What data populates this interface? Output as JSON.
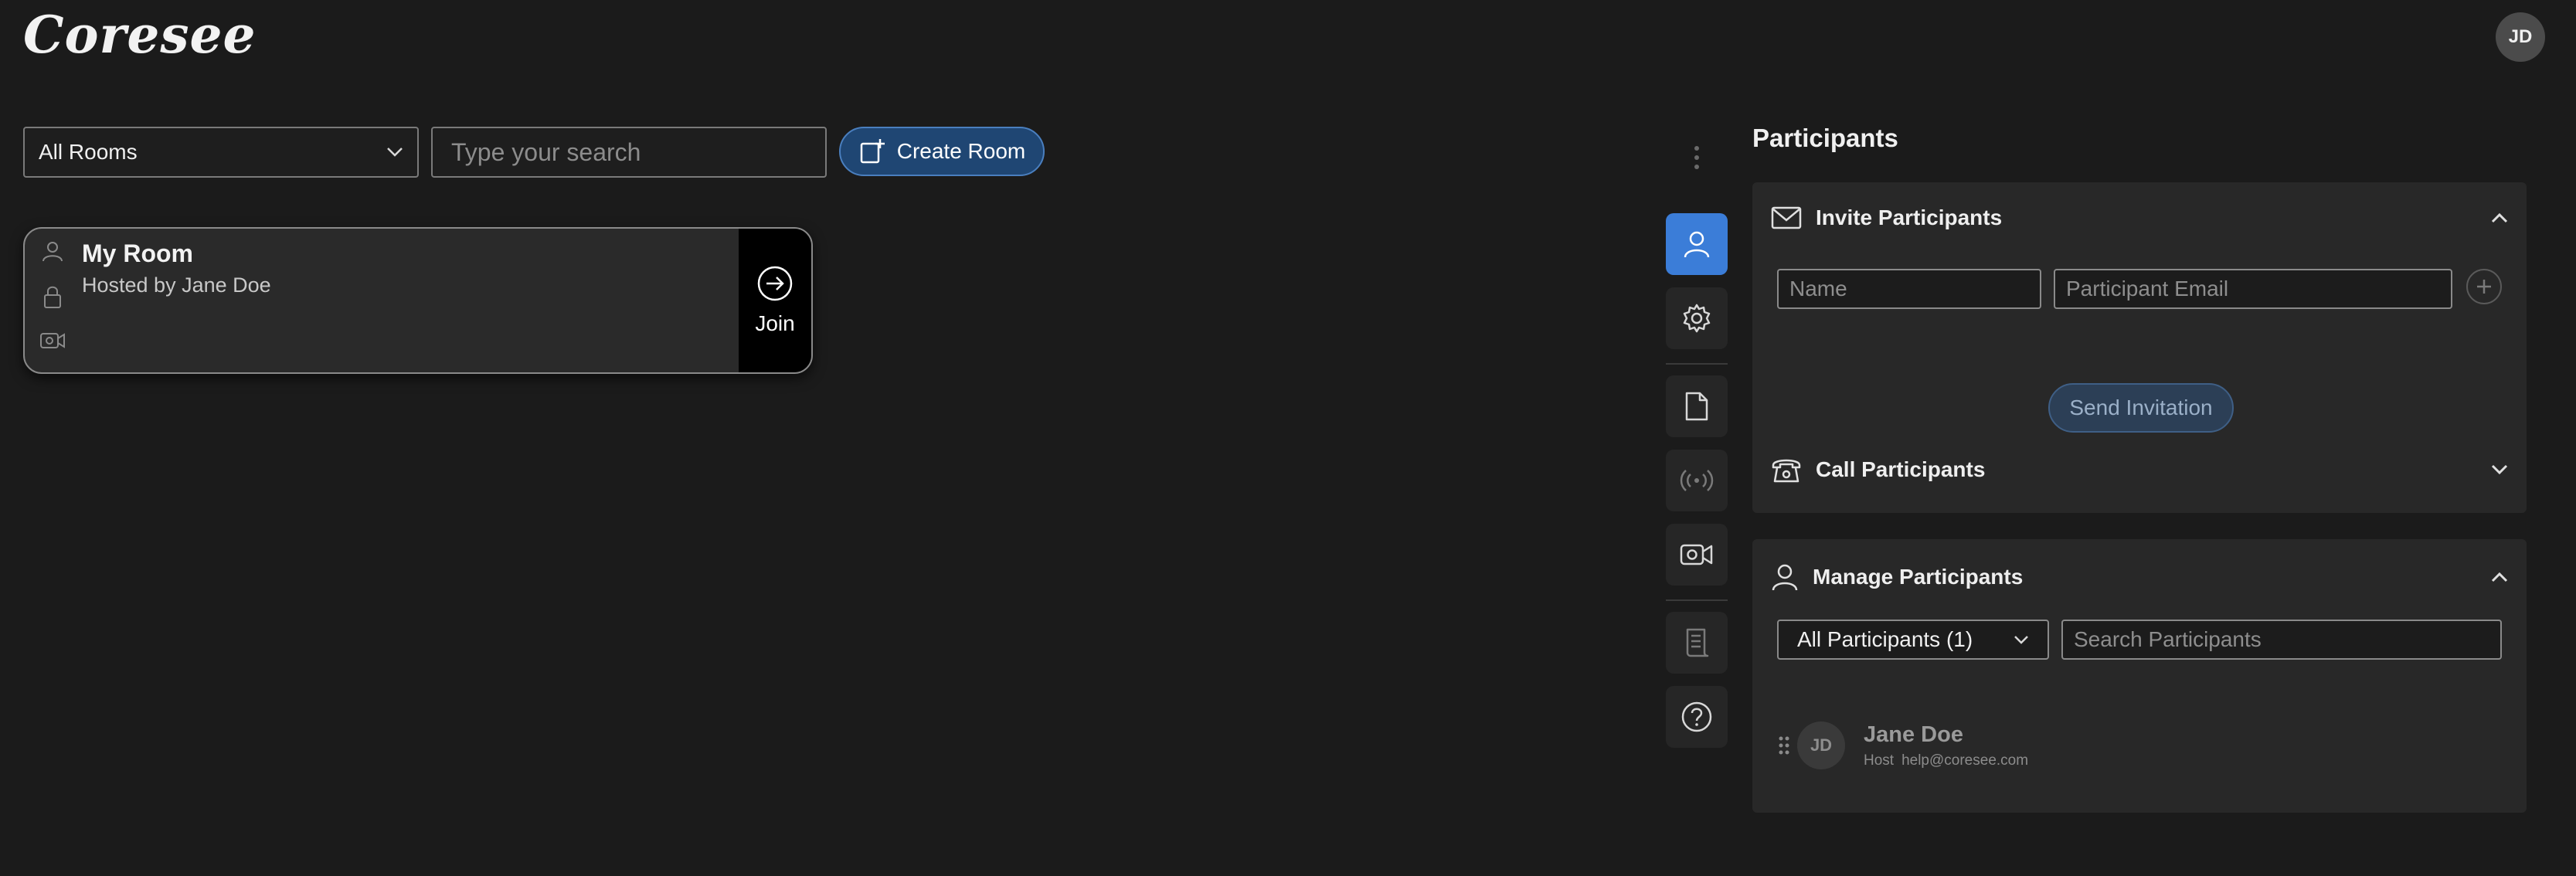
{
  "app": {
    "logo": "Coresee",
    "user_initials": "JD"
  },
  "toolbar": {
    "room_filter": "All Rooms",
    "search_placeholder": "Type your search",
    "create_room_label": "Create Room"
  },
  "room": {
    "title": "My Room",
    "host": "Hosted by Jane Doe",
    "join_label": "Join"
  },
  "panel": {
    "title": "Participants",
    "invite": {
      "heading": "Invite Participants",
      "name_placeholder": "Name",
      "email_placeholder": "Participant Email",
      "send_label": "Send Invitation"
    },
    "call": {
      "heading": "Call Participants"
    },
    "manage": {
      "heading": "Manage Participants",
      "filter": "All Participants (1)",
      "search_placeholder": "Search Participants",
      "participants": [
        {
          "initials": "JD",
          "name": "Jane Doe",
          "role": "Host",
          "email": "help@coresee.com"
        }
      ]
    }
  },
  "colors": {
    "background": "#1b1b1b",
    "accent": "#3b7dd8",
    "create_button": "#1f4673",
    "panel_card": "#282828"
  }
}
